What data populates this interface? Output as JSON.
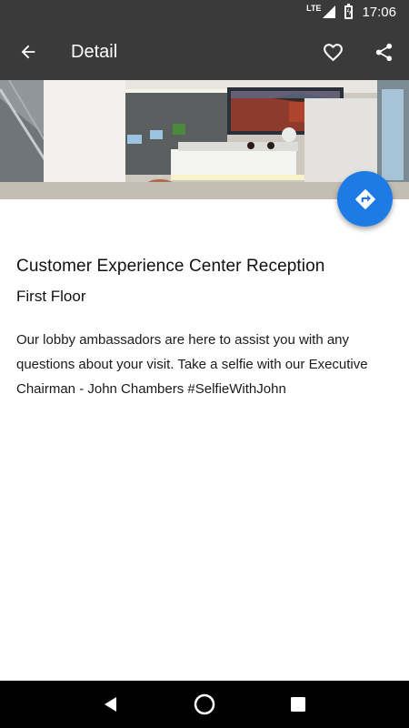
{
  "status_bar": {
    "network": "LTE",
    "time": "17:06"
  },
  "app_bar": {
    "title": "Detail",
    "back_icon": "arrow-back-icon",
    "favorite_icon": "heart-outline-icon",
    "share_icon": "share-icon"
  },
  "hero": {
    "image": "reception-lobby-photo"
  },
  "fab": {
    "icon": "directions-icon",
    "color": "#1e7be6"
  },
  "detail": {
    "title": "Customer Experience Center Reception",
    "floor": "First Floor",
    "description": "Our lobby ambassadors are here to assist you with any questions about your visit. Take a selfie with our Executive Chairman - John Chambers #SelfieWithJohn"
  },
  "nav_bar": {
    "back_icon": "nav-back-triangle-icon",
    "home_icon": "nav-home-circle-icon",
    "recents_icon": "nav-recents-square-icon"
  },
  "colors": {
    "app_bar": "#3a3a3a",
    "accent": "#1e7be6",
    "nav_bar": "#000000"
  }
}
